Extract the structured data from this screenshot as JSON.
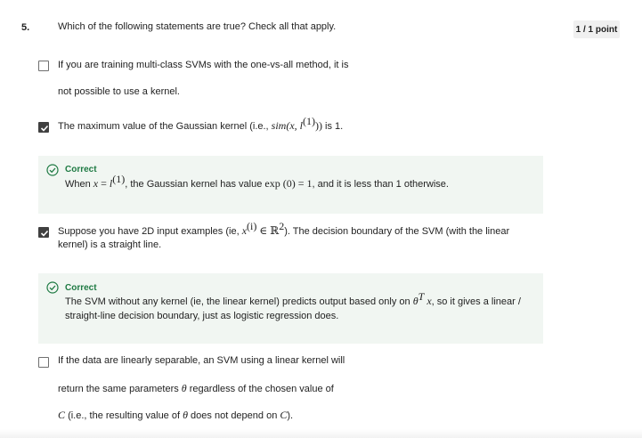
{
  "question": {
    "number": "5.",
    "prompt": "Which of the following statements are true? Check all that apply.",
    "score": "1 / 1 point"
  },
  "options": [
    {
      "checked": false,
      "line1": "If you are training multi-class SVMs with the one-vs-all method, it is",
      "line2": "not possible to use a kernel."
    },
    {
      "checked": true,
      "text_before": "The maximum value of the Gaussian kernel (i.e., ",
      "math_sim": "sim(x, l",
      "math_sup": "(1)",
      "math_close": "))",
      "text_after": " is 1.",
      "feedback": {
        "title": "Correct",
        "when": "When ",
        "math_x": "x",
        "eq": " = ",
        "math_l": "l",
        "sup": "(1)",
        "mid": ", the Gaussian kernel has value ",
        "math_exp": "exp (0) = 1",
        "end": ", and it is less than 1 otherwise."
      }
    },
    {
      "checked": true,
      "text_before": "Suppose you have 2D input examples (ie, ",
      "math_x": "x",
      "sup_i": "(i)",
      "math_in": " ∈ ℝ",
      "sup_2": "2",
      "text_after": "). The decision boundary of the SVM (with the linear",
      "line2": "kernel) is a straight line.",
      "feedback": {
        "title": "Correct",
        "line1_before": "The SVM without any kernel (ie, the linear kernel) predicts output based only on ",
        "math_theta": "θ",
        "sup_T": "T",
        "math_x": " x",
        "line1_after": ", so it gives a linear /",
        "line2": "straight-line decision boundary, just as logistic regression does."
      }
    },
    {
      "checked": false,
      "line1": "If the data are linearly separable, an SVM using a linear kernel will",
      "line2_before": "return the same parameters ",
      "theta": "θ",
      "line2_after": " regardless of the chosen value of",
      "line3_C": "C",
      "line3_mid": " (i.e., the resulting value of ",
      "line3_theta": "θ",
      "line3_mid2": " does not depend on ",
      "line3_C2": "C",
      "line3_end": ")."
    }
  ],
  "colors": {
    "correct_green": "#1e7a43",
    "feedback_bg": "#f1f6f2",
    "checkbox_checked": "#404040"
  }
}
